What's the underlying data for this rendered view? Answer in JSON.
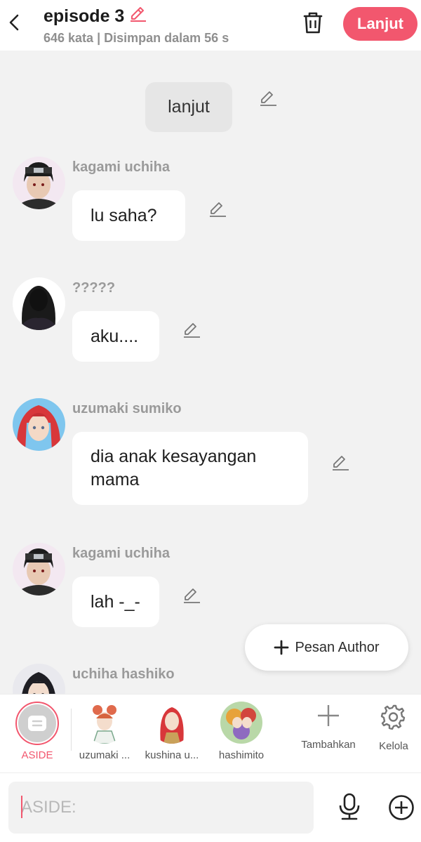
{
  "header": {
    "title": "episode 3",
    "word_count": "646 kata",
    "saved_status": "Disimpan dalam 56 s",
    "next_label": "Lanjut",
    "accent_color": "#f2576e"
  },
  "messages": [
    {
      "type": "narration",
      "text": "lanjut"
    },
    {
      "type": "chat",
      "name": "kagami uchiha",
      "text": "lu saha?"
    },
    {
      "type": "chat",
      "name": "?????",
      "text": "aku...."
    },
    {
      "type": "chat",
      "name": "uzumaki sumiko",
      "text": "dia anak kesayangan mama"
    },
    {
      "type": "chat",
      "name": "kagami uchiha",
      "text": "lah -_-"
    },
    {
      "type": "chat",
      "name": "uchiha hashiko",
      "text": ""
    }
  ],
  "pesan_author": {
    "icon": "plus-icon",
    "label": "Pesan Author"
  },
  "characters": [
    {
      "label": "ASIDE",
      "selected": true
    },
    {
      "label": "uzumaki ..."
    },
    {
      "label": "kushina u..."
    },
    {
      "label": "hashimito"
    }
  ],
  "tools": {
    "add_label": "Tambahkan",
    "manage_label": "Kelola"
  },
  "input": {
    "placeholder": "ASIDE:"
  }
}
